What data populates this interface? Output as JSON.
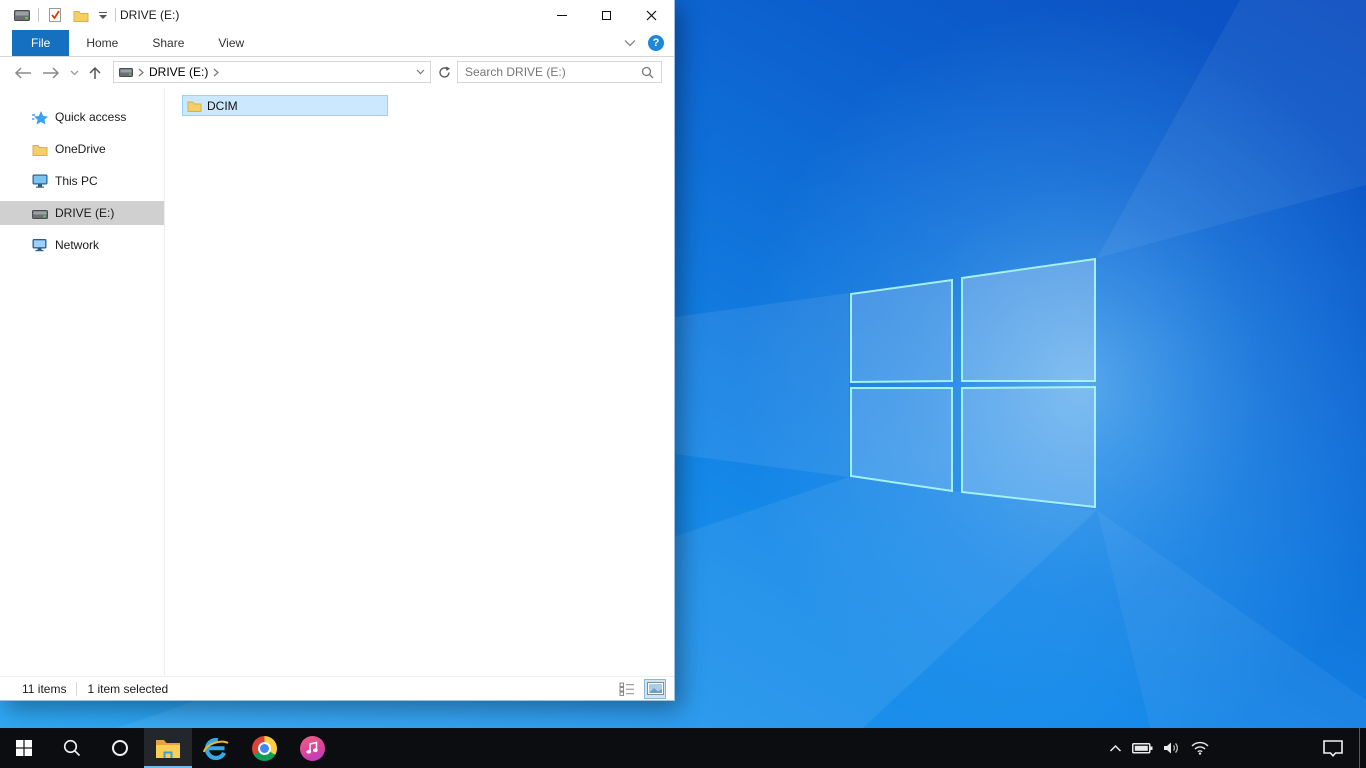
{
  "colors": {
    "file_tab_blue": "#1670c0",
    "help_circle_blue": "#1e88d8",
    "file_selection_bg": "#cce8ff",
    "file_selection_border": "#99d1ff",
    "sidebar_selected_bg": "#d0d0d0",
    "taskbar_bg": "#0c0d10",
    "taskbar_active_underline": "#76b9ed",
    "wallpaper_bright": "#31aaf3",
    "wallpaper_dark": "#0b4dc0"
  },
  "window": {
    "title": "DRIVE (E:)",
    "ribbon": {
      "tabs": [
        {
          "label": "File",
          "active": true
        },
        {
          "label": "Home",
          "active": false
        },
        {
          "label": "Share",
          "active": false
        },
        {
          "label": "View",
          "active": false
        }
      ],
      "help_glyph": "?"
    },
    "navigation": {
      "breadcrumb_location": "DRIVE (E:)",
      "search_placeholder": "Search DRIVE (E:)"
    },
    "sidebar": {
      "items": [
        {
          "label": "Quick access",
          "icon": "quick-access-star",
          "selected": false
        },
        {
          "label": "OneDrive",
          "icon": "onedrive-folder",
          "selected": false
        },
        {
          "label": "This PC",
          "icon": "this-pc-monitor",
          "selected": false
        },
        {
          "label": "DRIVE (E:)",
          "icon": "drive",
          "selected": true
        },
        {
          "label": "Network",
          "icon": "network-monitor",
          "selected": false
        }
      ]
    },
    "file_list": {
      "items": [
        {
          "name": "DCIM",
          "icon": "folder",
          "selected": true
        }
      ]
    },
    "status_bar": {
      "items_count": "11 items",
      "selection_count": "1 item selected"
    }
  },
  "taskbar": {
    "buttons": [
      {
        "name": "start",
        "active": false
      },
      {
        "name": "search",
        "active": false
      },
      {
        "name": "cortana",
        "active": false
      },
      {
        "name": "file-explorer",
        "active": true
      },
      {
        "name": "internet-explorer",
        "active": false
      },
      {
        "name": "chrome",
        "active": false
      },
      {
        "name": "itunes",
        "active": false
      }
    ],
    "tray_icons": [
      "chevron-up",
      "battery",
      "volume",
      "wifi",
      "action-center"
    ]
  }
}
